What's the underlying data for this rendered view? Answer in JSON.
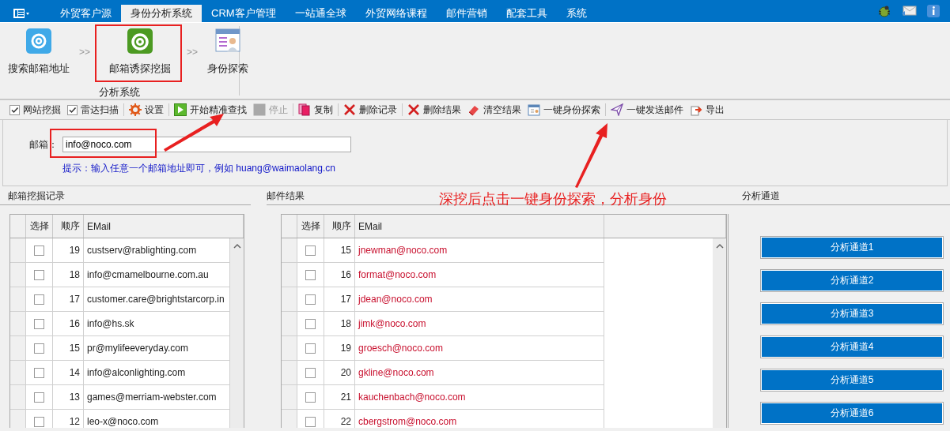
{
  "menu_tabs": [
    {
      "label": "外贸客户源",
      "selected": false
    },
    {
      "label": "身份分析系统",
      "selected": true
    },
    {
      "label": "CRM客户管理",
      "selected": false
    },
    {
      "label": "一站通全球",
      "selected": false
    },
    {
      "label": "外贸网络课程",
      "selected": false
    },
    {
      "label": "邮件营销",
      "selected": false
    },
    {
      "label": "配套工具",
      "selected": false
    },
    {
      "label": "系统",
      "selected": false
    }
  ],
  "ribbon": {
    "items": [
      {
        "kind": "button",
        "label": "搜索邮箱地址"
      },
      {
        "kind": "arrow",
        "text": ">>"
      },
      {
        "kind": "button",
        "label": "邮箱诱探挖掘"
      },
      {
        "kind": "arrow",
        "text": ">>"
      },
      {
        "kind": "button",
        "label": "身份探索"
      }
    ],
    "group_label": "分析系统"
  },
  "toolbar": [
    [
      {
        "kind": "checkbox",
        "label": "网站挖掘",
        "checked": true
      },
      {
        "kind": "checkbox",
        "label": "雷达扫描",
        "checked": true
      }
    ],
    [
      {
        "kind": "button",
        "label": "设置",
        "disabled": false
      }
    ],
    [
      {
        "kind": "button",
        "label": "开始精准查找",
        "disabled": false
      },
      {
        "kind": "button",
        "label": "停止",
        "disabled": true
      }
    ],
    [
      {
        "kind": "button",
        "label": "复制",
        "disabled": false
      }
    ],
    [
      {
        "kind": "button",
        "label": "删除记录",
        "disabled": false
      }
    ],
    [
      {
        "kind": "button",
        "label": "删除结果",
        "disabled": false
      },
      {
        "kind": "button",
        "label": "清空结果",
        "disabled": false
      },
      {
        "kind": "button",
        "label": "一键身份探索",
        "disabled": false
      }
    ],
    [
      {
        "kind": "button",
        "label": "一键发送邮件",
        "disabled": false
      },
      {
        "kind": "button",
        "label": "导出",
        "disabled": false
      }
    ]
  ],
  "form": {
    "label": "邮箱：",
    "value": "info@noco.com",
    "hint": "提示：输入任意一个邮箱地址即可，例如 huang@waimaolang.cn"
  },
  "records_panel": {
    "title": "邮箱挖掘记录",
    "columns": [
      "选择",
      "顺序",
      "EMail"
    ],
    "rows": [
      {
        "checked": false,
        "order": "19",
        "email": "custserv@rablighting.com"
      },
      {
        "checked": false,
        "order": "18",
        "email": "info@cmamelbourne.com.au"
      },
      {
        "checked": false,
        "order": "17",
        "email": "customer.care@brightstarcorp.in"
      },
      {
        "checked": false,
        "order": "16",
        "email": "info@hs.sk"
      },
      {
        "checked": false,
        "order": "15",
        "email": "pr@mylifeeveryday.com"
      },
      {
        "checked": false,
        "order": "14",
        "email": "info@alconlighting.com"
      },
      {
        "checked": false,
        "order": "13",
        "email": "games@merriam-webster.com"
      },
      {
        "checked": false,
        "order": "12",
        "email": "leo-x@noco.com"
      }
    ]
  },
  "results_panel": {
    "title": "邮件结果",
    "columns": [
      "选择",
      "顺序",
      "EMail"
    ],
    "rows": [
      {
        "checked": false,
        "order": "15",
        "email": "jnewman@noco.com"
      },
      {
        "checked": false,
        "order": "16",
        "email": "format@noco.com"
      },
      {
        "checked": false,
        "order": "17",
        "email": "jdean@noco.com"
      },
      {
        "checked": false,
        "order": "18",
        "email": "jimk@noco.com"
      },
      {
        "checked": false,
        "order": "19",
        "email": "groesch@noco.com"
      },
      {
        "checked": false,
        "order": "20",
        "email": "gkline@noco.com"
      },
      {
        "checked": false,
        "order": "21",
        "email": "kauchenbach@noco.com"
      },
      {
        "checked": false,
        "order": "22",
        "email": "cbergstrom@noco.com"
      }
    ]
  },
  "channels_panel": {
    "title": "分析通道",
    "buttons": [
      "分析通道1",
      "分析通道2",
      "分析通道3",
      "分析通道4",
      "分析通道5",
      "分析通道6"
    ]
  },
  "annotation": {
    "note": "深挖后点击一键身份探索，分析身份"
  }
}
